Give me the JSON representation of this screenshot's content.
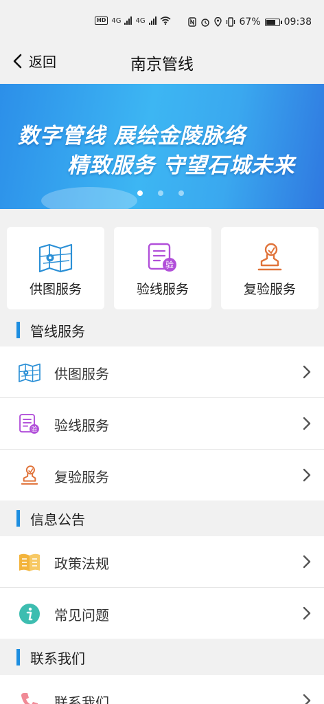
{
  "status_bar": {
    "network_badge": "HD",
    "network_1": "4G",
    "network_2": "4G",
    "battery": "67%",
    "time": "09:38"
  },
  "navbar": {
    "back_label": "返回",
    "title": "南京管线"
  },
  "banner": {
    "line1": "数字管线  展绘金陵脉络",
    "line2": "精致服务  守望石城未来",
    "slide_count": 3,
    "active_slide": 1
  },
  "quick_cards": [
    {
      "label": "供图服务",
      "icon": "map-icon"
    },
    {
      "label": "验线服务",
      "icon": "document-verify-icon"
    },
    {
      "label": "复验服务",
      "icon": "stamp-icon"
    }
  ],
  "sections": {
    "pipeline": {
      "title": "管线服务",
      "items": [
        {
          "label": "供图服务",
          "icon": "map-icon"
        },
        {
          "label": "验线服务",
          "icon": "document-verify-icon"
        },
        {
          "label": "复验服务",
          "icon": "stamp-icon"
        }
      ]
    },
    "info": {
      "title": "信息公告",
      "items": [
        {
          "label": "政策法规",
          "icon": "book-icon"
        },
        {
          "label": "常见问题",
          "icon": "info-icon"
        }
      ]
    },
    "contact": {
      "title": "联系我们",
      "items": [
        {
          "label": "联系我们",
          "icon": "phone-icon"
        }
      ]
    }
  },
  "icon_badge_text": "验",
  "colors": {
    "accent": "#1d8ee0",
    "map": "#2a8fd6",
    "verify": "#b14fd9",
    "stamp": "#e0733a",
    "book": "#f3b43c",
    "info": "#3dbdb0",
    "phone": "#f08a96"
  }
}
